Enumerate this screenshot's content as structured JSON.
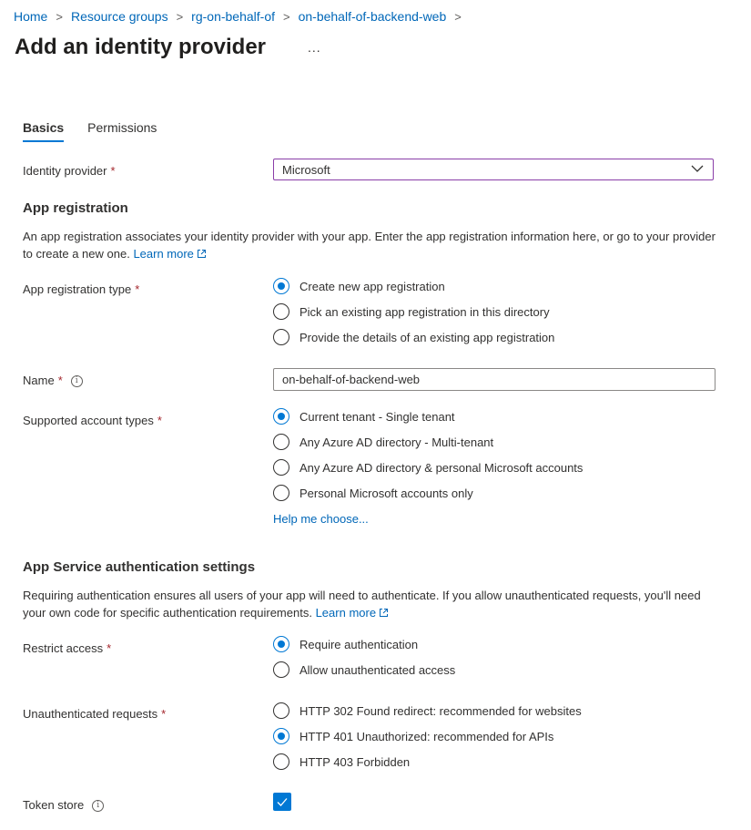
{
  "breadcrumb": [
    "Home",
    "Resource groups",
    "rg-on-behalf-of",
    "on-behalf-of-backend-web"
  ],
  "page_title": "Add an identity provider",
  "more_label": "...",
  "tabs": [
    {
      "label": "Basics",
      "active": true
    },
    {
      "label": "Permissions",
      "active": false
    }
  ],
  "identity_provider": {
    "label": "Identity provider",
    "value": "Microsoft"
  },
  "app_registration": {
    "title": "App registration",
    "description": "An app registration associates your identity provider with your app. Enter the app registration information here, or go to your provider to create a new one.",
    "learn_more": "Learn more",
    "type_label": "App registration type",
    "type_options": [
      {
        "label": "Create new app registration",
        "checked": true
      },
      {
        "label": "Pick an existing app registration in this directory",
        "checked": false
      },
      {
        "label": "Provide the details of an existing app registration",
        "checked": false
      }
    ],
    "name_label": "Name",
    "name_value": "on-behalf-of-backend-web",
    "account_types_label": "Supported account types",
    "account_types": [
      {
        "label": "Current tenant - Single tenant",
        "checked": true
      },
      {
        "label": "Any Azure AD directory - Multi-tenant",
        "checked": false
      },
      {
        "label": "Any Azure AD directory & personal Microsoft accounts",
        "checked": false
      },
      {
        "label": "Personal Microsoft accounts only",
        "checked": false
      }
    ],
    "help_link": "Help me choose..."
  },
  "auth_settings": {
    "title": "App Service authentication settings",
    "description": "Requiring authentication ensures all users of your app will need to authenticate. If you allow unauthenticated requests, you'll need your own code for specific authentication requirements.",
    "learn_more": "Learn more",
    "restrict_label": "Restrict access",
    "restrict_options": [
      {
        "label": "Require authentication",
        "checked": true
      },
      {
        "label": "Allow unauthenticated access",
        "checked": false
      }
    ],
    "unauth_label": "Unauthenticated requests",
    "unauth_options": [
      {
        "label": "HTTP 302 Found redirect: recommended for websites",
        "checked": false
      },
      {
        "label": "HTTP 401 Unauthorized: recommended for APIs",
        "checked": true
      },
      {
        "label": "HTTP 403 Forbidden",
        "checked": false
      }
    ],
    "token_store_label": "Token store",
    "token_store_checked": true
  },
  "required_marker": "*",
  "info_glyph": "i",
  "colors": {
    "accent": "#0078d4",
    "link": "#0067b8",
    "required": "#a4262c",
    "select_border": "#8a3ea8"
  }
}
